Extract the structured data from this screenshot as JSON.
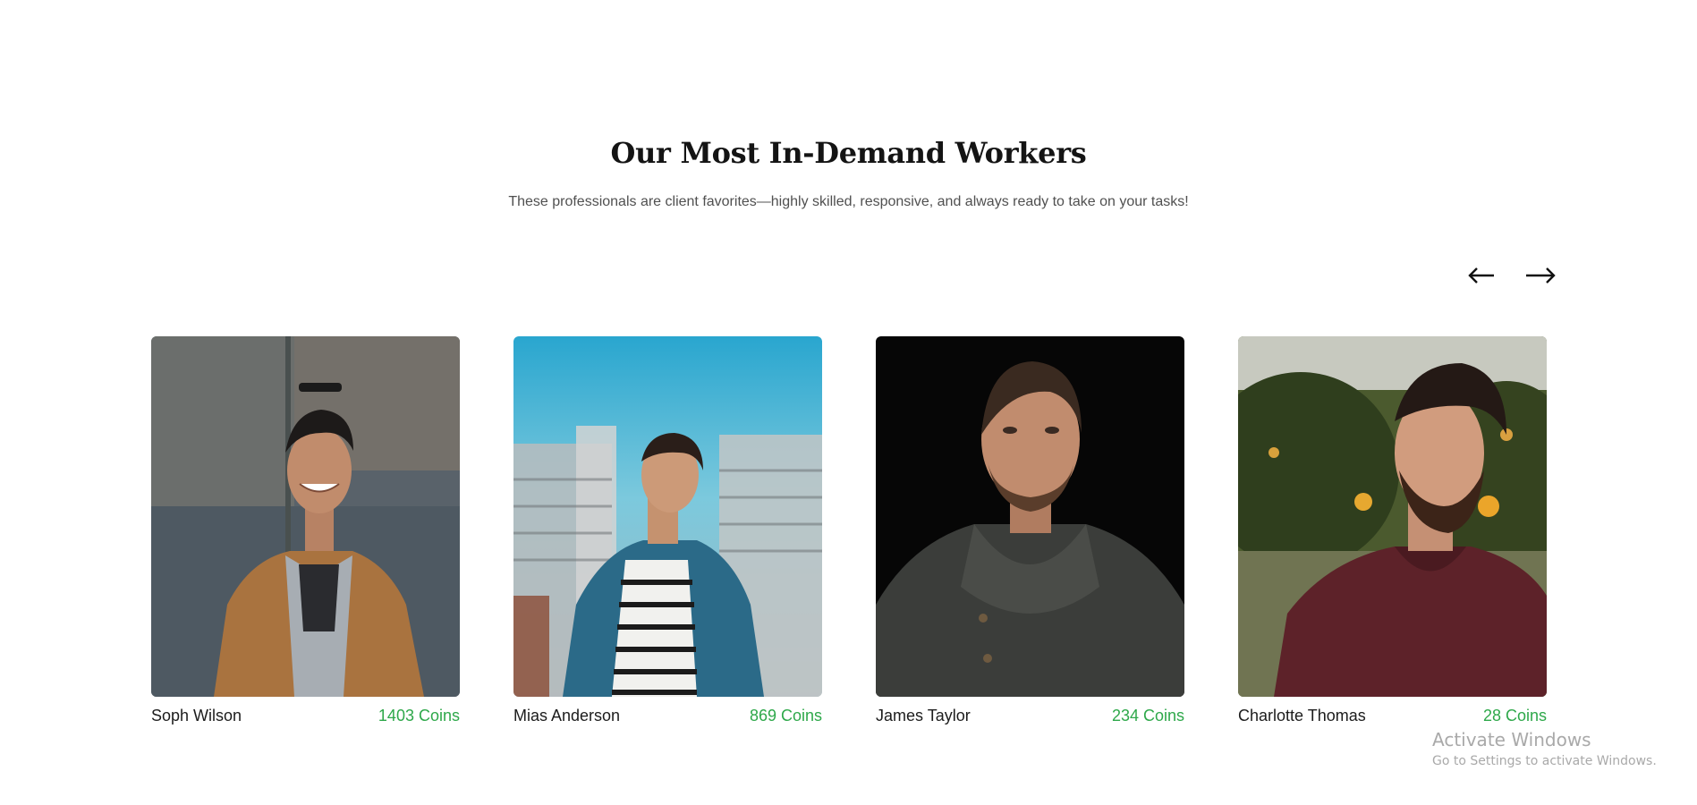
{
  "section": {
    "title": "Our Most In-Demand Workers",
    "subtitle": "These professionals are client favorites—highly skilled, responsive, and always ready to take on your tasks!"
  },
  "carousel": {
    "prev_icon": "arrow-left-icon",
    "next_icon": "arrow-right-icon"
  },
  "workers": [
    {
      "name": "Soph Wilson",
      "coins": "1403 Coins"
    },
    {
      "name": "Mias Anderson",
      "coins": "869 Coins"
    },
    {
      "name": "James Taylor",
      "coins": "234 Coins"
    },
    {
      "name": "Charlotte Thomas",
      "coins": "28 Coins"
    }
  ],
  "watermark": {
    "title": "Activate Windows",
    "subtitle": "Go to Settings to activate Windows."
  },
  "colors": {
    "coins": "#2ea84a",
    "title": "#141414",
    "subtitle": "#505050"
  }
}
